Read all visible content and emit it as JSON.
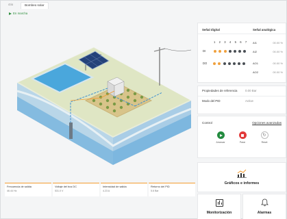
{
  "tabs": [
    "ctio",
    "Bombeo solar"
  ],
  "status": {
    "text": "En marcha",
    "color": "#2f8f3e"
  },
  "scene": {
    "icon": "solar-pumping-system-illustration"
  },
  "metrics": [
    {
      "label": "Frecuencia de salida",
      "value": "46.44 Hz"
    },
    {
      "label": "Voltaje del bus DC",
      "value": "531.0 V"
    },
    {
      "label": "Intensidad de salida",
      "value": "4.23 A"
    },
    {
      "label": "Retorno del PID",
      "value": "5.6 Bar"
    }
  ],
  "signals": {
    "digital_header": "Señal digital",
    "analog_header": "Señal analógica",
    "numbers": [
      "1",
      "2",
      "3",
      "4",
      "5",
      "6",
      "7"
    ],
    "rows": [
      {
        "label": "DI",
        "dots": [
          "o",
          "o",
          "o",
          "d",
          "d",
          "d",
          "d"
        ]
      },
      {
        "label": "DO",
        "dots": [
          "o",
          "o",
          "d",
          "d",
          "d",
          "d",
          "d"
        ]
      }
    ],
    "analog": [
      {
        "name": "AI1",
        "value": "00.00 %"
      },
      {
        "name": "AI2",
        "value": "00.00 %"
      },
      {
        "name": "AO1",
        "value": "00.00 %"
      },
      {
        "name": "AO2",
        "value": "00.00 %"
      }
    ]
  },
  "pid": {
    "ref_label": "Propiedades de referencia",
    "ref_value": "0.00 Bar",
    "mode_label": "Modo del PID",
    "mode_value": "Active"
  },
  "control": {
    "title": "Control",
    "advanced": "Opciones avanzadas",
    "start": "Arrancar",
    "stop": "Parar",
    "reset": "Reset"
  },
  "graphs_label": "Gráficos e informes",
  "monitoring_label": "Monitorización",
  "alarms_label": "Alarmas",
  "colors": {
    "accent": "#f39a2c",
    "go": "#238b3f",
    "stop": "#e23b3b"
  }
}
